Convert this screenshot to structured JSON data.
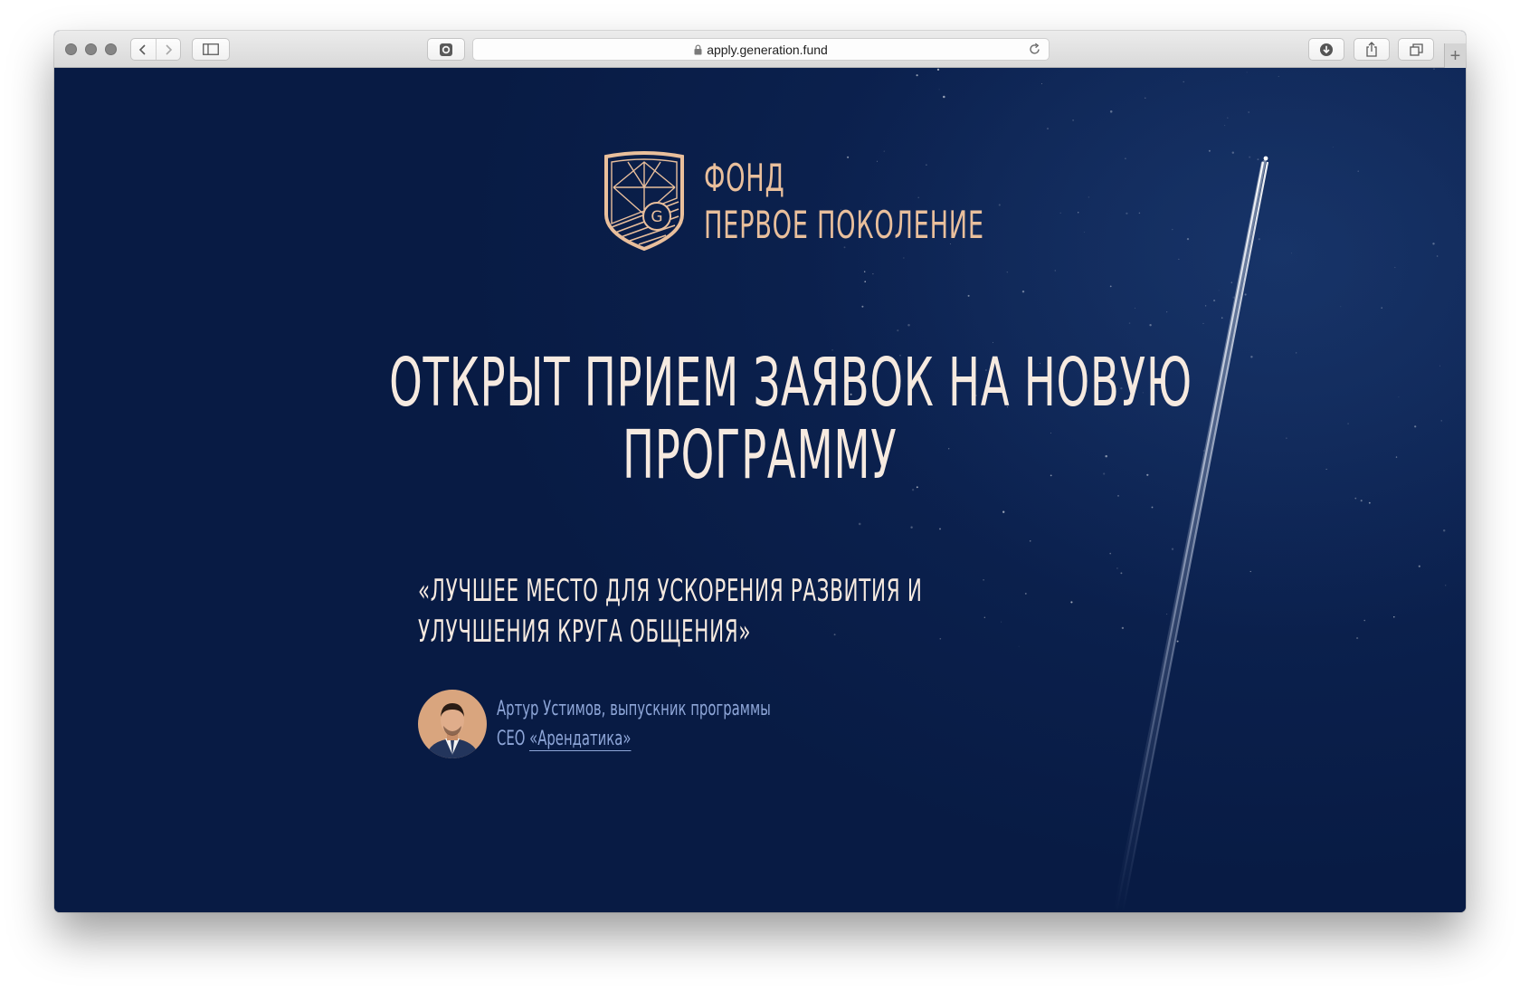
{
  "browser": {
    "url": "apply.generation.fund"
  },
  "logo": {
    "line1": "ФОНД",
    "line2": "ПЕРВОЕ ПОКОЛЕНИЕ",
    "emblem_letter": "G",
    "color": "#e9bf9c"
  },
  "hero": {
    "headline_line1": "ОТКРЫТ ПРИЕМ ЗАЯВОК НА НОВУЮ",
    "headline_line2": "ПРОГРАММУ"
  },
  "testimonial": {
    "quote_line1": "«ЛУЧШЕЕ МЕСТО ДЛЯ УСКОРЕНИЯ РАЗВИТИЯ И",
    "quote_line2": "УЛУЧШЕНИЯ КРУГА ОБЩЕНИЯ»",
    "author_line": "Артур Устимов, выпускник программы",
    "role": "CEO",
    "company": "«Арендатика»"
  },
  "colors": {
    "background": "#0a1f4a",
    "headline": "#f6eae0",
    "author_text": "#8ea6d8"
  }
}
